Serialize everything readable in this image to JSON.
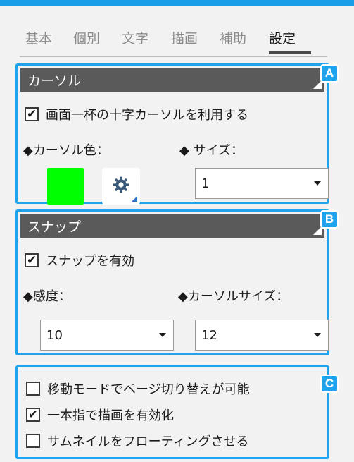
{
  "tabs": [
    "基本",
    "個別",
    "文字",
    "描画",
    "補助",
    "設定"
  ],
  "active_tab": "設定",
  "colors": {
    "accent": "#1fa3ec",
    "header": "#5a5a5a",
    "cursor_color": "#00ff00"
  },
  "cursor_section": {
    "badge": "A",
    "title": "カーソル",
    "crosshair": {
      "label": "画面一杯の十字カーソルを利用する",
      "checked": true
    },
    "color_label": "◆カーソル色：",
    "size_label": "◆ サイズ：",
    "size_value": "1",
    "icons": [
      "gear-icon"
    ]
  },
  "snap_section": {
    "badge": "B",
    "title": "スナップ",
    "enable": {
      "label": "スナップを有効",
      "checked": true
    },
    "sensitivity_label": "◆感度：",
    "cursor_size_label": "◆カーソルサイズ：",
    "sensitivity_value": "10",
    "cursor_size_value": "12"
  },
  "misc_section": {
    "badge": "C",
    "options": [
      {
        "label": "移動モードでページ切り替えが可能",
        "checked": false
      },
      {
        "label": "一本指で描画を有効化",
        "checked": true
      },
      {
        "label": "サムネイルをフローティングさせる",
        "checked": false
      }
    ]
  }
}
